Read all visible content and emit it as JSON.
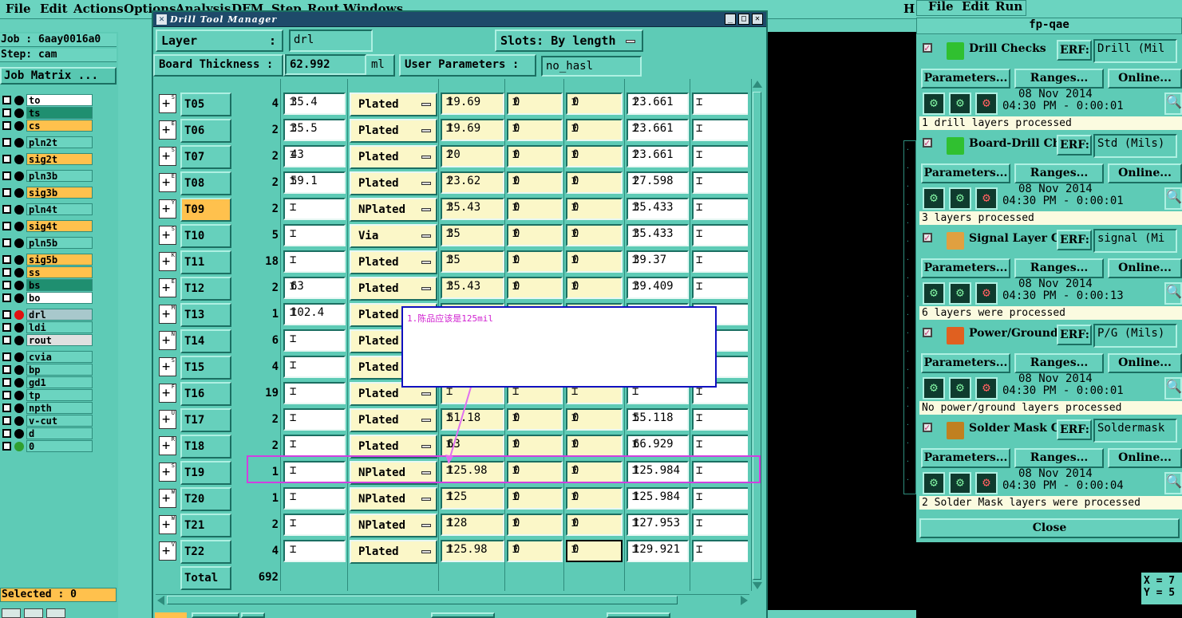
{
  "menubar": {
    "items": [
      "File",
      "Edit",
      "Actions",
      "Options",
      "Analysis",
      "DFM",
      "Step",
      "Rout",
      "Windows"
    ],
    "right_label": "H"
  },
  "job_info": {
    "job": "Job : 6aay0016a0",
    "step": "Step: cam",
    "job_matrix_button": "Job Matrix ..."
  },
  "layers": [
    {
      "name": "to",
      "color": "#ffffff",
      "pen": true
    },
    {
      "name": "ts",
      "color": "#1f8f70",
      "pen": true
    },
    {
      "name": "cs",
      "color": "#ffc14d",
      "pen": true
    },
    {
      "name": "pln2t",
      "color": "#6bd4c0",
      "pen": false
    },
    {
      "name": "sig2t",
      "color": "#ffc14d",
      "pen": true
    },
    {
      "name": "pln3b",
      "color": "#6bd4c0",
      "pen": false
    },
    {
      "name": "sig3b",
      "color": "#ffc14d",
      "pen": true
    },
    {
      "name": "pln4t",
      "color": "#6bd4c0",
      "pen": false
    },
    {
      "name": "sig4t",
      "color": "#ffc14d",
      "pen": true
    },
    {
      "name": "pln5b",
      "color": "#6bd4c0",
      "pen": false
    },
    {
      "name": "sig5b",
      "color": "#ffc14d",
      "pen": true
    },
    {
      "name": "ss",
      "color": "#ffc14d",
      "pen": true
    },
    {
      "name": "bs",
      "color": "#1f8f70",
      "pen": true
    },
    {
      "name": "bo",
      "color": "#ffffff",
      "pen": true
    },
    {
      "name": "drl",
      "color": "#a8c8cc",
      "pen": false,
      "active": true
    },
    {
      "name": "ldi",
      "color": "#6bd4c0",
      "pen": false
    },
    {
      "name": "rout",
      "color": "#e0e0e0",
      "pen": false
    },
    {
      "name": "cvia",
      "color": "#6bd4c0",
      "pen": false
    },
    {
      "name": "bp",
      "color": "#6bd4c0",
      "pen": true
    },
    {
      "name": "gd1",
      "color": "#6bd4c0",
      "pen": true
    },
    {
      "name": "tp",
      "color": "#6bd4c0",
      "pen": true
    },
    {
      "name": "npth",
      "color": "#6bd4c0",
      "pen": false
    },
    {
      "name": "v-cut",
      "color": "#6bd4c0",
      "pen": false
    },
    {
      "name": "d",
      "color": "#6bd4c0",
      "pen": false
    },
    {
      "name": "0",
      "color": "#6bd4c0",
      "pen": true,
      "green_dot": true
    }
  ],
  "selected_text": "Selected : 0",
  "dtm": {
    "title": "Drill Tool Manager",
    "layer_label": "Layer",
    "layer_value": "drl",
    "slots_label": "Slots:",
    "slots_value": "By length",
    "board_thickness_label": "Board Thickness :",
    "board_thickness_value": "62.992",
    "board_thickness_unit": "ml",
    "user_params_label": "User Parameters :",
    "user_params_value": "no_hasl",
    "total_label": "Total",
    "total_count": "692",
    "rows": [
      {
        "tool": "T05",
        "count": "4",
        "size": "35.4",
        "type": "Plated",
        "d1": "19.69",
        "d2": "0",
        "d3": "0",
        "fin": "23.661",
        "sel": false
      },
      {
        "tool": "T06",
        "count": "2",
        "size": "35.5",
        "type": "Plated",
        "d1": "19.69",
        "d2": "0",
        "d3": "0",
        "fin": "23.661",
        "sel": false
      },
      {
        "tool": "T07",
        "count": "2",
        "size": "43",
        "type": "Plated",
        "d1": "20",
        "d2": "0",
        "d3": "0",
        "fin": "23.661",
        "sel": false
      },
      {
        "tool": "T08",
        "count": "2",
        "size": "59.1",
        "type": "Plated",
        "d1": "23.62",
        "d2": "0",
        "d3": "0",
        "fin": "27.598",
        "sel": false
      },
      {
        "tool": "T09",
        "count": "2",
        "size": "",
        "type": "NPlated",
        "d1": "35.43",
        "d2": "0",
        "d3": "0",
        "fin": "35.433",
        "sel": true
      },
      {
        "tool": "T10",
        "count": "5",
        "size": "",
        "type": "Via",
        "d1": "35",
        "d2": "0",
        "d3": "0",
        "fin": "35.433",
        "sel": false
      },
      {
        "tool": "T11",
        "count": "18",
        "size": "",
        "type": "Plated",
        "d1": "35",
        "d2": "0",
        "d3": "0",
        "fin": "39.37",
        "sel": false
      },
      {
        "tool": "T12",
        "count": "2",
        "size": "63",
        "type": "Plated",
        "d1": "35.43",
        "d2": "0",
        "d3": "0",
        "fin": "39.409",
        "sel": false
      },
      {
        "tool": "T13",
        "count": "1",
        "size": "102.4",
        "type": "Plated",
        "d1": "",
        "d2": "",
        "d3": "",
        "fin": "",
        "sel": false
      },
      {
        "tool": "T14",
        "count": "6",
        "size": "",
        "type": "Plated",
        "d1": "",
        "d2": "",
        "d3": "",
        "fin": "",
        "sel": false
      },
      {
        "tool": "T15",
        "count": "4",
        "size": "",
        "type": "Plated",
        "d1": "",
        "d2": "",
        "d3": "",
        "fin": "",
        "sel": false
      },
      {
        "tool": "T16",
        "count": "19",
        "size": "",
        "type": "Plated",
        "d1": "",
        "d2": "",
        "d3": "",
        "fin": "",
        "sel": false
      },
      {
        "tool": "T17",
        "count": "2",
        "size": "",
        "type": "Plated",
        "d1": "51.18",
        "d2": "0",
        "d3": "0",
        "fin": "55.118",
        "sel": false
      },
      {
        "tool": "T18",
        "count": "2",
        "size": "",
        "type": "Plated",
        "d1": "63",
        "d2": "0",
        "d3": "0",
        "fin": "66.929",
        "sel": false
      },
      {
        "tool": "T19",
        "count": "1",
        "size": "",
        "type": "NPlated",
        "d1": "125.98",
        "d2": "0",
        "d3": "0",
        "fin": "125.984",
        "sel": false
      },
      {
        "tool": "T20",
        "count": "1",
        "size": "",
        "type": "NPlated",
        "d1": "125",
        "d2": "0",
        "d3": "0",
        "fin": "125.984",
        "sel": false
      },
      {
        "tool": "T21",
        "count": "2",
        "size": "",
        "type": "NPlated",
        "d1": "128",
        "d2": "0",
        "d3": "0",
        "fin": "127.953",
        "sel": false
      },
      {
        "tool": "T22",
        "count": "4",
        "size": "",
        "type": "Plated",
        "d1": "125.98",
        "d2": "0",
        "d3": "0",
        "fin": "129.921",
        "sel": false
      }
    ]
  },
  "annotation": {
    "text": "1.陈品应该是125mil",
    "box_color": "#1010c0",
    "text_color": "#d020d0",
    "highlight_color": "#d040e0"
  },
  "coord": {
    "x": "X = 7",
    "y": "Y = 5"
  },
  "fpqae": {
    "menu": [
      "File",
      "Edit",
      "Run"
    ],
    "title": "fp-qae",
    "erf_label": "ERF:",
    "params_btn": "Parameters...",
    "ranges_btn": "Ranges...",
    "online_btn": "Online...",
    "close_btn": "Close",
    "checks": [
      {
        "name": "Drill Checks",
        "erf": "Drill (Mil",
        "date": "08 Nov 2014",
        "time": "04:30 PM - 0:00:01",
        "status": "1 drill layers processed",
        "icon_color": "#30c030"
      },
      {
        "name": "Board-Drill Che",
        "erf": "Std (Mils)",
        "date": "08 Nov 2014",
        "time": "04:30 PM - 0:00:01",
        "status": "3 layers processed",
        "icon_color": "#30c030"
      },
      {
        "name": "Signal Layer Ch",
        "erf": "signal (Mi",
        "date": "08 Nov 2014",
        "time": "04:30 PM - 0:00:13",
        "status": "6 layers were processed",
        "icon_color": "#e0a040"
      },
      {
        "name": "Power/Ground C",
        "erf": "P/G (Mils)",
        "date": "08 Nov 2014",
        "time": "04:30 PM - 0:00:01",
        "status": "No power/ground layers processed",
        "icon_color": "#e06020"
      },
      {
        "name": "Solder Mask Ch",
        "erf": "Soldermask",
        "date": "08 Nov 2014",
        "time": "04:30 PM - 0:00:04",
        "status": "2 Solder Mask layers were processed",
        "icon_color": "#c08020"
      }
    ]
  }
}
